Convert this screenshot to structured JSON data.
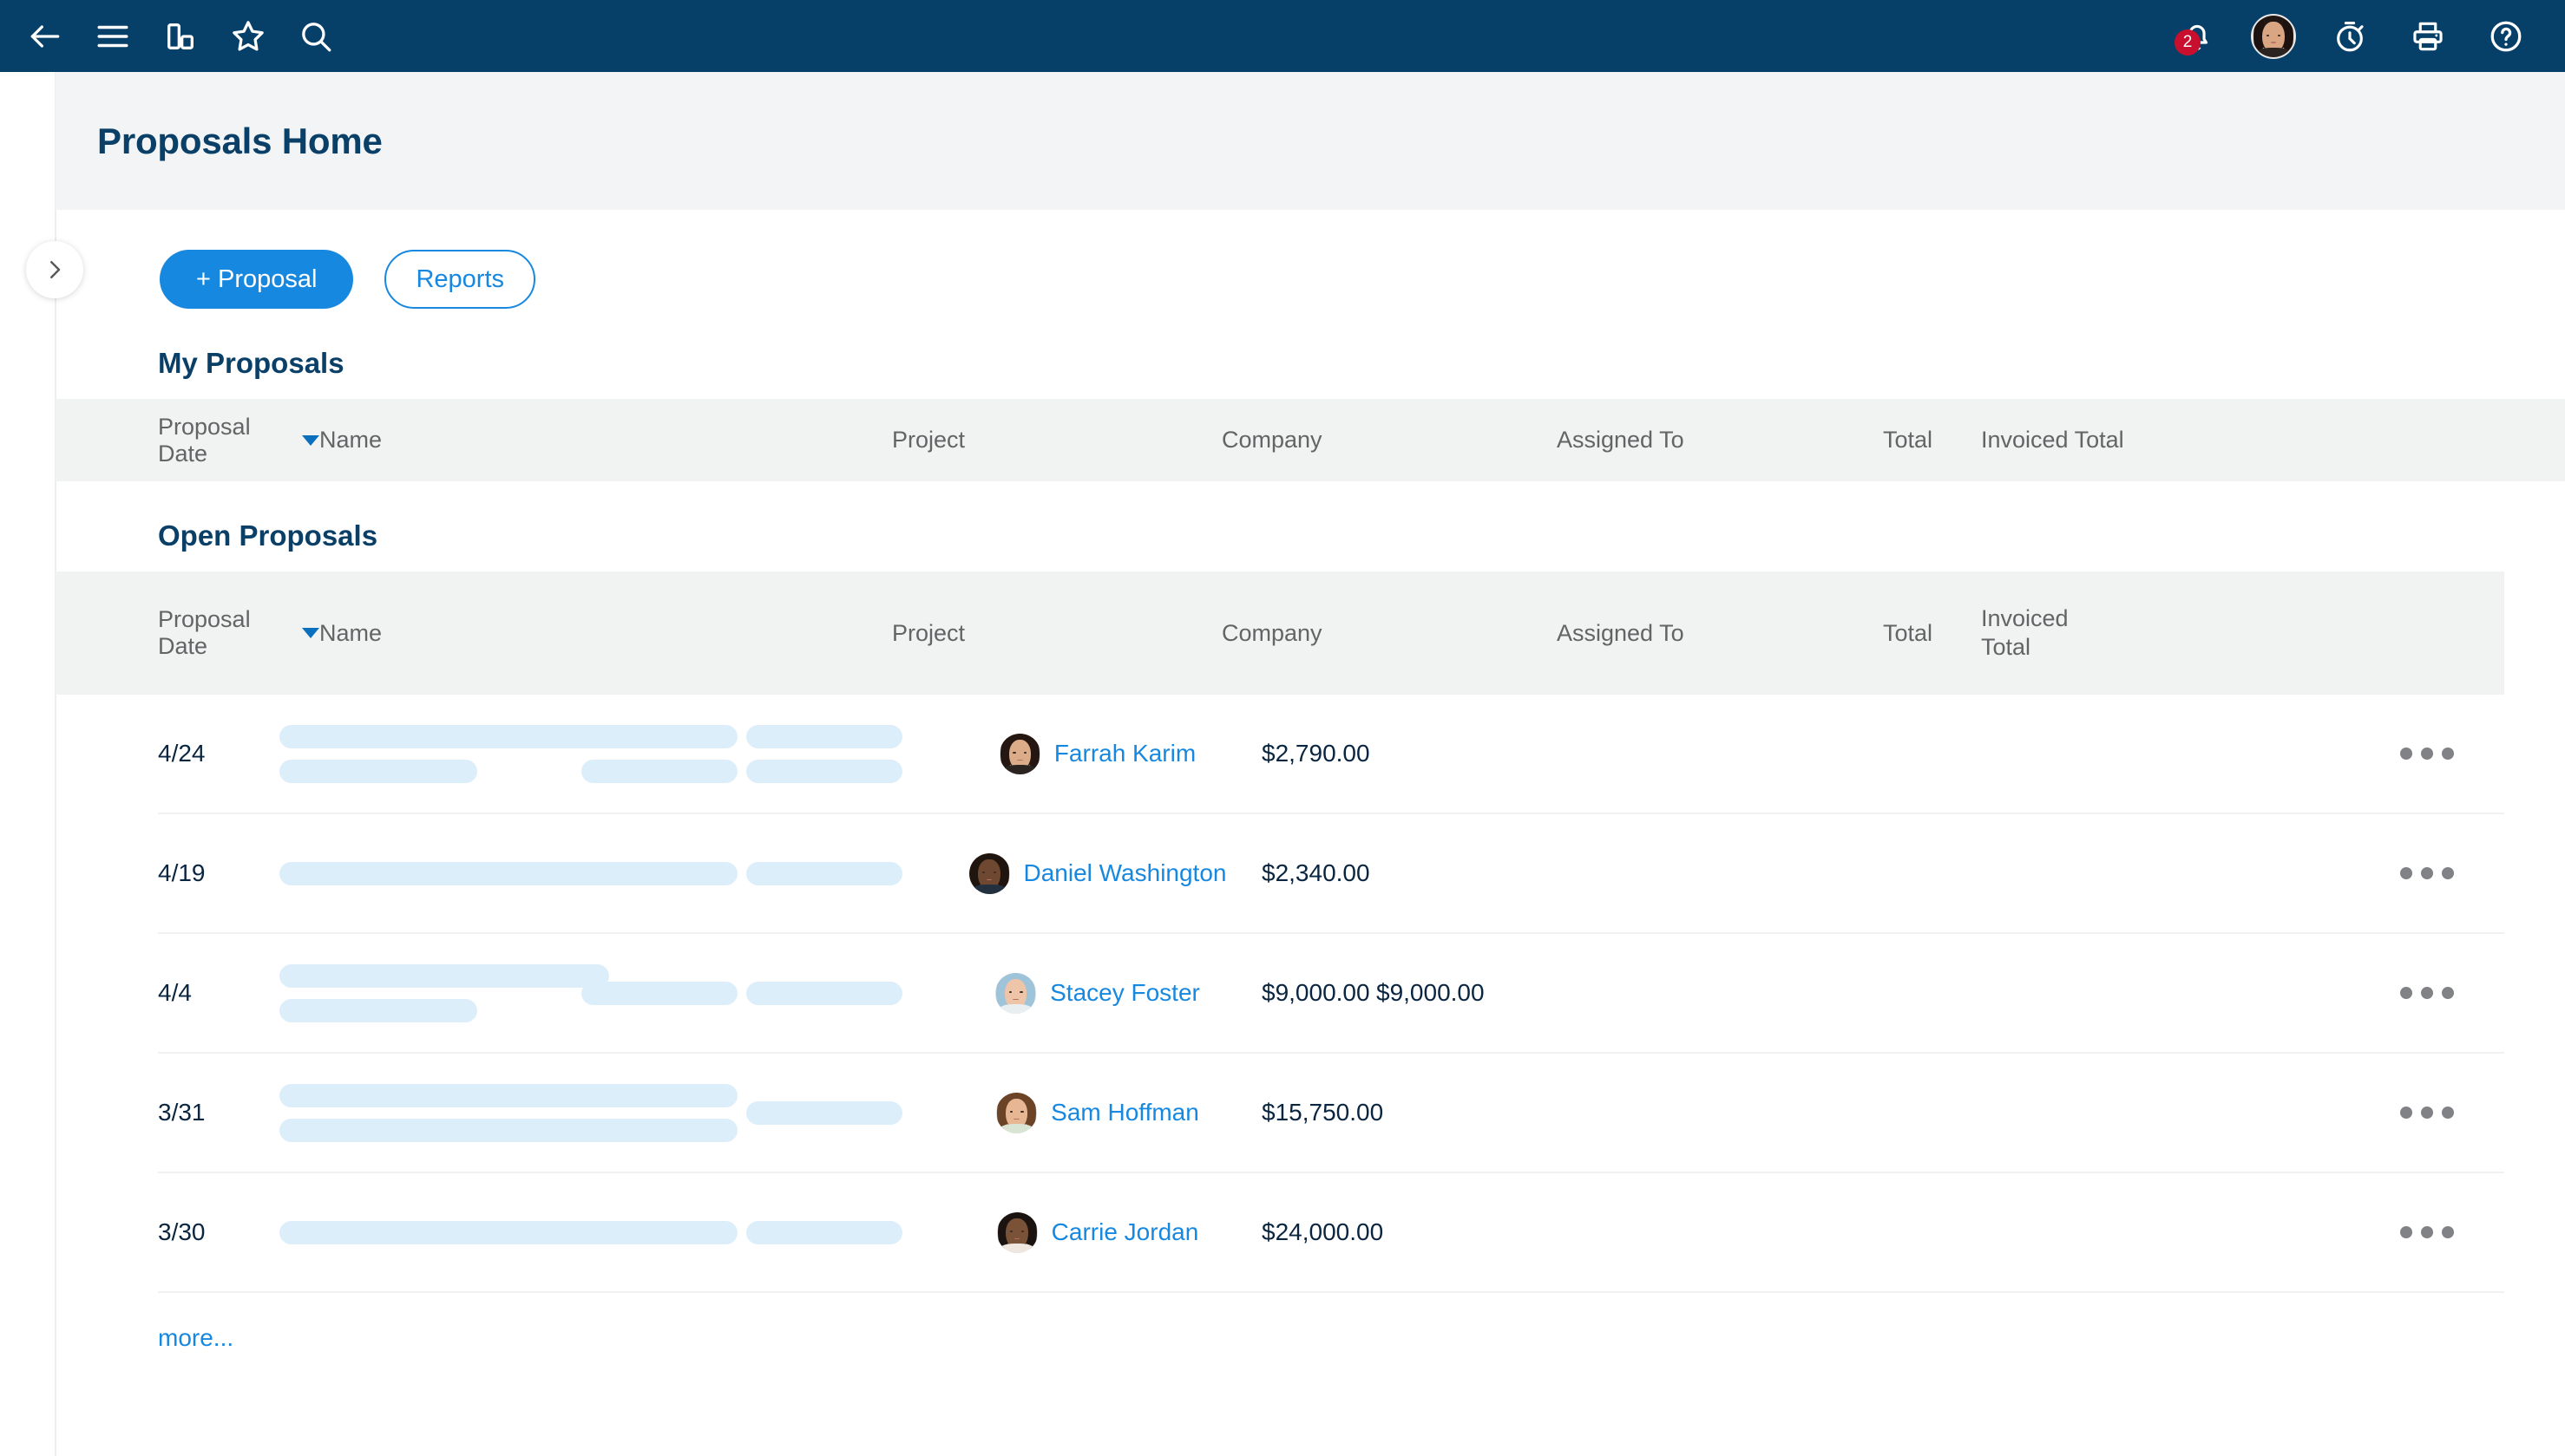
{
  "topnav": {
    "background": "#063f68",
    "left_icons": [
      {
        "name": "back-arrow-icon",
        "label": "Back"
      },
      {
        "name": "hamburger-menu-icon",
        "label": "Menu"
      },
      {
        "name": "bar-chart-icon",
        "label": "Dashboards"
      },
      {
        "name": "star-icon",
        "label": "Favorites"
      },
      {
        "name": "search-icon",
        "label": "Search"
      }
    ],
    "right_icons": [
      {
        "name": "notifications-bell-icon",
        "label": "Notifications",
        "badge": "2"
      },
      {
        "name": "user-avatar",
        "label": "Account"
      },
      {
        "name": "timer-icon",
        "label": "Timer"
      },
      {
        "name": "print-icon",
        "label": "Print"
      },
      {
        "name": "help-icon",
        "label": "Help"
      }
    ],
    "badge_color": "#c8102e"
  },
  "rail": {
    "toggle_icon": "chevron-right-icon",
    "toggle_label": "Expand navigation"
  },
  "header": {
    "title": "Proposals Home",
    "background": "#f2f4f6",
    "title_color": "#0a4068"
  },
  "actions": {
    "new_proposal_label": "+ Proposal",
    "reports_label": "Reports",
    "primary_color": "#1788e0"
  },
  "my_proposals": {
    "title": "My Proposals",
    "columns": [
      {
        "key": "date",
        "label": "Proposal Date",
        "sorted": true
      },
      {
        "key": "name",
        "label": "Name"
      },
      {
        "key": "project",
        "label": "Project"
      },
      {
        "key": "company",
        "label": "Company"
      },
      {
        "key": "assigned",
        "label": "Assigned To"
      },
      {
        "key": "total",
        "label": "Total"
      },
      {
        "key": "invoiced",
        "label": "Invoiced Total"
      }
    ],
    "rows": []
  },
  "open_proposals": {
    "title": "Open Proposals",
    "columns": [
      {
        "key": "date",
        "label": "Proposal Date",
        "sorted": true
      },
      {
        "key": "name",
        "label": "Name"
      },
      {
        "key": "project",
        "label": "Project"
      },
      {
        "key": "company",
        "label": "Company"
      },
      {
        "key": "assigned",
        "label": "Assigned To"
      },
      {
        "key": "total",
        "label": "Total"
      },
      {
        "key": "invoiced_line1",
        "label": "Invoiced"
      },
      {
        "key": "invoiced_line2",
        "label": "Total"
      }
    ],
    "rows": [
      {
        "date": "4/24",
        "name_bars": [
          380,
          228
        ],
        "project_bars": [
          180,
          180
        ],
        "company_bars": [
          180,
          180
        ],
        "assigned_to": "Farrah Karim",
        "total": "$2,790.00",
        "invoiced_total": "",
        "row_menu": "row-actions-menu"
      },
      {
        "date": "4/19",
        "name_bars": [
          380
        ],
        "project_bars": [
          180
        ],
        "company_bars": [
          180
        ],
        "assigned_to": "Daniel Washington",
        "total": "$2,340.00",
        "invoiced_total": "",
        "row_menu": "row-actions-menu"
      },
      {
        "date": "4/4",
        "name_bars": [
          380,
          228
        ],
        "project_bars": [
          180
        ],
        "company_bars": [
          180
        ],
        "assigned_to": "Stacey Foster",
        "total": "$9,000.00",
        "invoiced_total": "$9,000.00",
        "row_menu": "row-actions-menu"
      },
      {
        "date": "3/31",
        "name_bars": [
          380,
          380
        ],
        "project_bars": [
          180,
          180
        ],
        "company_bars": [
          180
        ],
        "assigned_to": "Sam Hoffman",
        "total": "$15,750.00",
        "invoiced_total": "",
        "row_menu": "row-actions-menu"
      },
      {
        "date": "3/30",
        "name_bars": [
          380
        ],
        "project_bars": [
          180
        ],
        "company_bars": [
          180
        ],
        "assigned_to": "Carrie Jordan",
        "total": "$24,000.00",
        "invoiced_total": "",
        "row_menu": "row-actions-menu"
      }
    ],
    "more_label": "more...",
    "link_color": "#1788e0",
    "redacted_bar_color": "#ddeefb"
  }
}
